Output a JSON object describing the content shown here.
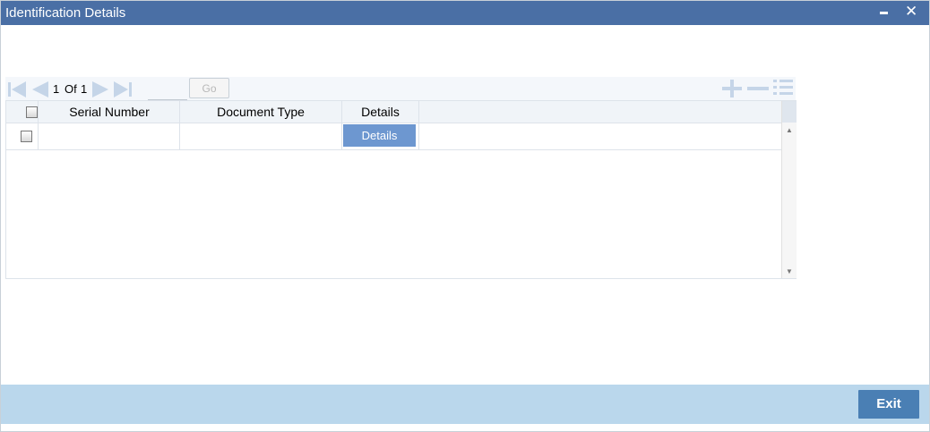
{
  "window": {
    "title": "Identification Details",
    "minimize_icon": "minimize-icon",
    "close_glyph": "✕"
  },
  "toolbar": {
    "first_icon": "first-page-icon",
    "prev_icon": "previous-page-icon",
    "current_page": "1",
    "of_label": "Of",
    "total_pages": "1",
    "next_icon": "next-page-icon",
    "last_icon": "last-page-icon",
    "goto_value": "",
    "go_label": "Go",
    "add_icon": "add-row-icon",
    "delete_icon": "delete-row-icon",
    "view_icon": "single-view-icon"
  },
  "grid": {
    "columns": [
      "Serial Number",
      "Document Type",
      "Details"
    ],
    "rows": [
      {
        "serial_number": "",
        "document_type": "",
        "details_label": "Details"
      }
    ]
  },
  "footer": {
    "exit_label": "Exit"
  },
  "colors": {
    "titlebar": "#4a6fa5",
    "footer": "#bad7ec",
    "exit_button": "#4a7fb4",
    "details_button": "#6d97d0"
  }
}
